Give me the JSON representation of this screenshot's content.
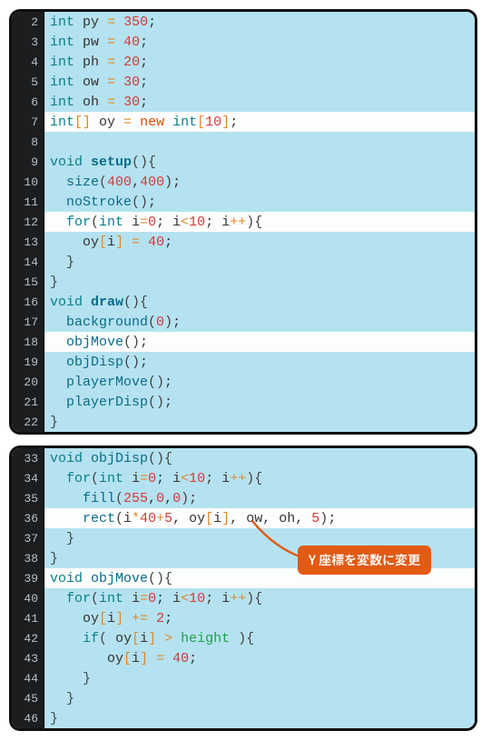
{
  "block1": {
    "lines": [
      {
        "n": 2,
        "hl": true,
        "tokens": [
          [
            "type",
            "int"
          ],
          [
            "sp",
            " "
          ],
          [
            "ident",
            "py"
          ],
          [
            "sp",
            " "
          ],
          [
            "op",
            "="
          ],
          [
            "sp",
            " "
          ],
          [
            "num",
            "350"
          ],
          [
            "punc",
            ";"
          ]
        ]
      },
      {
        "n": 3,
        "hl": true,
        "tokens": [
          [
            "type",
            "int"
          ],
          [
            "sp",
            " "
          ],
          [
            "ident",
            "pw"
          ],
          [
            "sp",
            " "
          ],
          [
            "op",
            "="
          ],
          [
            "sp",
            " "
          ],
          [
            "num",
            "40"
          ],
          [
            "punc",
            ";"
          ]
        ]
      },
      {
        "n": 4,
        "hl": true,
        "tokens": [
          [
            "type",
            "int"
          ],
          [
            "sp",
            " "
          ],
          [
            "ident",
            "ph"
          ],
          [
            "sp",
            " "
          ],
          [
            "op",
            "="
          ],
          [
            "sp",
            " "
          ],
          [
            "num",
            "20"
          ],
          [
            "punc",
            ";"
          ]
        ]
      },
      {
        "n": 5,
        "hl": true,
        "tokens": [
          [
            "type",
            "int"
          ],
          [
            "sp",
            " "
          ],
          [
            "ident",
            "ow"
          ],
          [
            "sp",
            " "
          ],
          [
            "op",
            "="
          ],
          [
            "sp",
            " "
          ],
          [
            "num",
            "30"
          ],
          [
            "punc",
            ";"
          ]
        ]
      },
      {
        "n": 6,
        "hl": true,
        "tokens": [
          [
            "type",
            "int"
          ],
          [
            "sp",
            " "
          ],
          [
            "ident",
            "oh"
          ],
          [
            "sp",
            " "
          ],
          [
            "op",
            "="
          ],
          [
            "sp",
            " "
          ],
          [
            "num",
            "30"
          ],
          [
            "punc",
            ";"
          ]
        ]
      },
      {
        "n": 7,
        "hl": false,
        "tokens": [
          [
            "type",
            "int"
          ],
          [
            "arr",
            "[]"
          ],
          [
            "sp",
            " "
          ],
          [
            "ident",
            "oy"
          ],
          [
            "sp",
            " "
          ],
          [
            "op",
            "="
          ],
          [
            "sp",
            " "
          ],
          [
            "new",
            "new"
          ],
          [
            "sp",
            " "
          ],
          [
            "type",
            "int"
          ],
          [
            "arr",
            "["
          ],
          [
            "num",
            "10"
          ],
          [
            "arr",
            "]"
          ],
          [
            "punc",
            ";"
          ]
        ]
      },
      {
        "n": 8,
        "hl": true,
        "tokens": []
      },
      {
        "n": 9,
        "hl": true,
        "tokens": [
          [
            "type",
            "void"
          ],
          [
            "sp",
            " "
          ],
          [
            "funcdef",
            "setup"
          ],
          [
            "brace",
            "(){"
          ]
        ]
      },
      {
        "n": 10,
        "hl": true,
        "tokens": [
          [
            "sp",
            "  "
          ],
          [
            "call",
            "size"
          ],
          [
            "brace",
            "("
          ],
          [
            "num",
            "400"
          ],
          [
            "punc",
            ","
          ],
          [
            "num",
            "400"
          ],
          [
            "brace",
            ")"
          ],
          [
            "punc",
            ";"
          ]
        ]
      },
      {
        "n": 11,
        "hl": true,
        "tokens": [
          [
            "sp",
            "  "
          ],
          [
            "call",
            "noStroke"
          ],
          [
            "brace",
            "()"
          ],
          [
            "punc",
            ";"
          ]
        ]
      },
      {
        "n": 12,
        "hl": false,
        "tokens": [
          [
            "sp",
            "  "
          ],
          [
            "keyword",
            "for"
          ],
          [
            "brace",
            "("
          ],
          [
            "type",
            "int"
          ],
          [
            "sp",
            " "
          ],
          [
            "ident",
            "i"
          ],
          [
            "op",
            "="
          ],
          [
            "num",
            "0"
          ],
          [
            "punc",
            "; "
          ],
          [
            "ident",
            "i"
          ],
          [
            "op",
            "<"
          ],
          [
            "num",
            "10"
          ],
          [
            "punc",
            "; "
          ],
          [
            "ident",
            "i"
          ],
          [
            "op",
            "++"
          ],
          [
            "brace",
            "){"
          ]
        ]
      },
      {
        "n": 13,
        "hl": true,
        "tokens": [
          [
            "sp",
            "    "
          ],
          [
            "ident",
            "oy"
          ],
          [
            "arr",
            "["
          ],
          [
            "ident",
            "i"
          ],
          [
            "arr",
            "]"
          ],
          [
            "sp",
            " "
          ],
          [
            "op",
            "="
          ],
          [
            "sp",
            " "
          ],
          [
            "num",
            "40"
          ],
          [
            "punc",
            ";"
          ]
        ]
      },
      {
        "n": 14,
        "hl": true,
        "tokens": [
          [
            "sp",
            "  "
          ],
          [
            "brace",
            "}"
          ]
        ]
      },
      {
        "n": 15,
        "hl": true,
        "tokens": [
          [
            "brace",
            "}"
          ]
        ]
      },
      {
        "n": 16,
        "hl": true,
        "tokens": [
          [
            "type",
            "void"
          ],
          [
            "sp",
            " "
          ],
          [
            "funcdef",
            "draw"
          ],
          [
            "brace",
            "(){"
          ]
        ]
      },
      {
        "n": 17,
        "hl": true,
        "tokens": [
          [
            "sp",
            "  "
          ],
          [
            "call",
            "background"
          ],
          [
            "brace",
            "("
          ],
          [
            "num",
            "0"
          ],
          [
            "brace",
            ")"
          ],
          [
            "punc",
            ";"
          ]
        ]
      },
      {
        "n": 18,
        "hl": false,
        "tokens": [
          [
            "sp",
            "  "
          ],
          [
            "call",
            "objMove"
          ],
          [
            "brace",
            "()"
          ],
          [
            "punc",
            ";"
          ]
        ]
      },
      {
        "n": 19,
        "hl": true,
        "tokens": [
          [
            "sp",
            "  "
          ],
          [
            "call",
            "objDisp"
          ],
          [
            "brace",
            "()"
          ],
          [
            "punc",
            ";"
          ]
        ]
      },
      {
        "n": 20,
        "hl": true,
        "tokens": [
          [
            "sp",
            "  "
          ],
          [
            "call",
            "playerMove"
          ],
          [
            "brace",
            "()"
          ],
          [
            "punc",
            ";"
          ]
        ]
      },
      {
        "n": 21,
        "hl": true,
        "tokens": [
          [
            "sp",
            "  "
          ],
          [
            "call",
            "playerDisp"
          ],
          [
            "brace",
            "()"
          ],
          [
            "punc",
            ";"
          ]
        ]
      },
      {
        "n": 22,
        "hl": true,
        "tokens": [
          [
            "brace",
            "}"
          ]
        ]
      }
    ]
  },
  "block2": {
    "lines": [
      {
        "n": 33,
        "hl": true,
        "tokens": [
          [
            "type",
            "void"
          ],
          [
            "sp",
            " "
          ],
          [
            "call",
            "objDisp"
          ],
          [
            "brace",
            "(){"
          ]
        ]
      },
      {
        "n": 34,
        "hl": true,
        "tokens": [
          [
            "sp",
            "  "
          ],
          [
            "keyword",
            "for"
          ],
          [
            "brace",
            "("
          ],
          [
            "type",
            "int"
          ],
          [
            "sp",
            " "
          ],
          [
            "ident",
            "i"
          ],
          [
            "op",
            "="
          ],
          [
            "num",
            "0"
          ],
          [
            "punc",
            "; "
          ],
          [
            "ident",
            "i"
          ],
          [
            "op",
            "<"
          ],
          [
            "num",
            "10"
          ],
          [
            "punc",
            "; "
          ],
          [
            "ident",
            "i"
          ],
          [
            "op",
            "++"
          ],
          [
            "brace",
            "){"
          ]
        ]
      },
      {
        "n": 35,
        "hl": true,
        "tokens": [
          [
            "sp",
            "    "
          ],
          [
            "call",
            "fill"
          ],
          [
            "brace",
            "("
          ],
          [
            "num",
            "255"
          ],
          [
            "punc",
            ","
          ],
          [
            "num",
            "0"
          ],
          [
            "punc",
            ","
          ],
          [
            "num",
            "0"
          ],
          [
            "brace",
            ")"
          ],
          [
            "punc",
            ";"
          ]
        ]
      },
      {
        "n": 36,
        "hl": false,
        "tokens": [
          [
            "sp",
            "    "
          ],
          [
            "call",
            "rect"
          ],
          [
            "brace",
            "("
          ],
          [
            "ident",
            "i"
          ],
          [
            "op",
            "*"
          ],
          [
            "num",
            "40"
          ],
          [
            "op",
            "+"
          ],
          [
            "num",
            "5"
          ],
          [
            "punc",
            ", "
          ],
          [
            "ident",
            "oy"
          ],
          [
            "arr",
            "["
          ],
          [
            "ident",
            "i"
          ],
          [
            "arr",
            "]"
          ],
          [
            "punc",
            ", "
          ],
          [
            "ident",
            "ow"
          ],
          [
            "punc",
            ", "
          ],
          [
            "ident",
            "oh"
          ],
          [
            "punc",
            ", "
          ],
          [
            "num",
            "5"
          ],
          [
            "brace",
            ")"
          ],
          [
            "punc",
            ";"
          ]
        ]
      },
      {
        "n": 37,
        "hl": true,
        "tokens": [
          [
            "sp",
            "  "
          ],
          [
            "brace",
            "}"
          ]
        ]
      },
      {
        "n": 38,
        "hl": true,
        "tokens": [
          [
            "brace",
            "}"
          ]
        ]
      },
      {
        "n": 39,
        "hl": false,
        "tokens": [
          [
            "type",
            "void"
          ],
          [
            "sp",
            " "
          ],
          [
            "call",
            "objMove"
          ],
          [
            "brace",
            "(){"
          ]
        ]
      },
      {
        "n": 40,
        "hl": true,
        "tokens": [
          [
            "sp",
            "  "
          ],
          [
            "keyword",
            "for"
          ],
          [
            "brace",
            "("
          ],
          [
            "type",
            "int"
          ],
          [
            "sp",
            " "
          ],
          [
            "ident",
            "i"
          ],
          [
            "op",
            "="
          ],
          [
            "num",
            "0"
          ],
          [
            "punc",
            "; "
          ],
          [
            "ident",
            "i"
          ],
          [
            "op",
            "<"
          ],
          [
            "num",
            "10"
          ],
          [
            "punc",
            "; "
          ],
          [
            "ident",
            "i"
          ],
          [
            "op",
            "++"
          ],
          [
            "brace",
            "){"
          ]
        ]
      },
      {
        "n": 41,
        "hl": true,
        "tokens": [
          [
            "sp",
            "    "
          ],
          [
            "ident",
            "oy"
          ],
          [
            "arr",
            "["
          ],
          [
            "ident",
            "i"
          ],
          [
            "arr",
            "]"
          ],
          [
            "sp",
            " "
          ],
          [
            "op",
            "+="
          ],
          [
            "sp",
            " "
          ],
          [
            "num",
            "2"
          ],
          [
            "punc",
            ";"
          ]
        ]
      },
      {
        "n": 42,
        "hl": true,
        "tokens": [
          [
            "sp",
            "    "
          ],
          [
            "keyword",
            "if"
          ],
          [
            "brace",
            "("
          ],
          [
            "sp",
            " "
          ],
          [
            "ident",
            "oy"
          ],
          [
            "arr",
            "["
          ],
          [
            "ident",
            "i"
          ],
          [
            "arr",
            "]"
          ],
          [
            "sp",
            " "
          ],
          [
            "op",
            ">"
          ],
          [
            "sp",
            " "
          ],
          [
            "special",
            "height"
          ],
          [
            "sp",
            " "
          ],
          [
            "brace",
            "){"
          ]
        ]
      },
      {
        "n": 43,
        "hl": true,
        "tokens": [
          [
            "sp",
            "       "
          ],
          [
            "ident",
            "oy"
          ],
          [
            "arr",
            "["
          ],
          [
            "ident",
            "i"
          ],
          [
            "arr",
            "]"
          ],
          [
            "sp",
            " "
          ],
          [
            "op",
            "="
          ],
          [
            "sp",
            " "
          ],
          [
            "num",
            "40"
          ],
          [
            "punc",
            ";"
          ]
        ]
      },
      {
        "n": 44,
        "hl": true,
        "tokens": [
          [
            "sp",
            "    "
          ],
          [
            "brace",
            "}"
          ]
        ]
      },
      {
        "n": 45,
        "hl": true,
        "tokens": [
          [
            "sp",
            "  "
          ],
          [
            "brace",
            "}"
          ]
        ]
      },
      {
        "n": 46,
        "hl": true,
        "tokens": [
          [
            "brace",
            "}"
          ]
        ]
      }
    ]
  },
  "callout": {
    "text": "Y 座標を変数に変更"
  }
}
